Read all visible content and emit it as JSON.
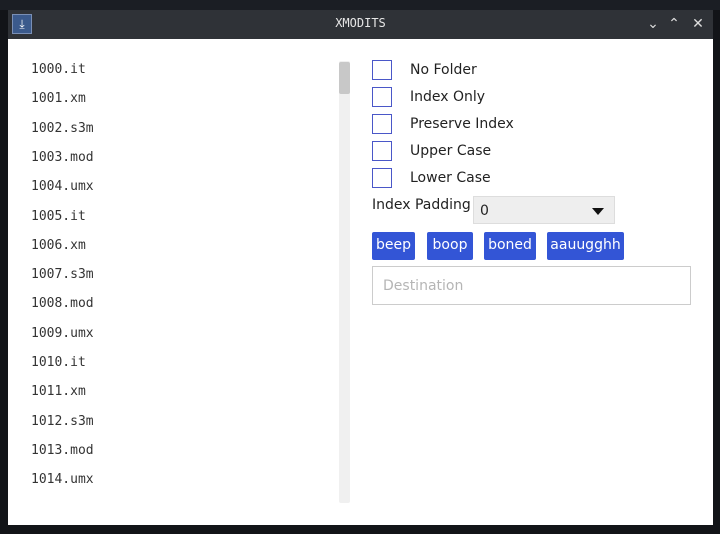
{
  "window": {
    "title": "XMODITS",
    "icons": {
      "app": "xmodits-icon",
      "minimize": "chevron-down-icon",
      "maximize": "chevron-up-icon",
      "close": "close-icon"
    }
  },
  "file_list": {
    "items": [
      "1000.it",
      "1001.xm",
      "1002.s3m",
      "1003.mod",
      "1004.umx",
      "1005.it",
      "1006.xm",
      "1007.s3m",
      "1008.mod",
      "1009.umx",
      "1010.it",
      "1011.xm",
      "1012.s3m",
      "1013.mod",
      "1014.umx"
    ]
  },
  "options": {
    "checkboxes": [
      {
        "label": "No Folder",
        "checked": false
      },
      {
        "label": "Index Only",
        "checked": false
      },
      {
        "label": "Preserve Index",
        "checked": false
      },
      {
        "label": "Upper Case",
        "checked": false
      },
      {
        "label": "Lower Case",
        "checked": false
      }
    ]
  },
  "index_padding": {
    "label": "Index Padding",
    "value": "0"
  },
  "buttons": [
    "beep",
    "boop",
    "boned",
    "aauugghh"
  ],
  "destination": {
    "placeholder": "Destination",
    "value": ""
  },
  "colors": {
    "accent": "#3355d6",
    "titlebar": "#2f3237"
  }
}
